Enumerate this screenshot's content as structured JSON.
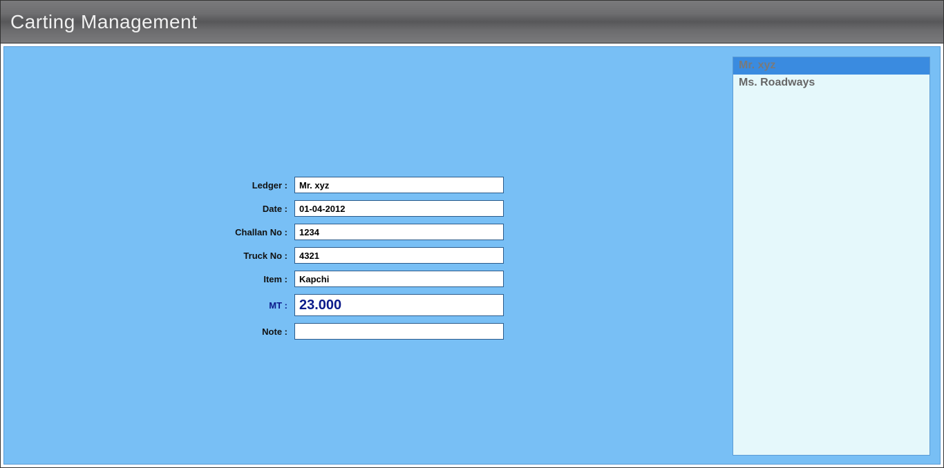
{
  "header": {
    "title": "Carting Management"
  },
  "form": {
    "ledger": {
      "label": "Ledger :",
      "value": "Mr. xyz"
    },
    "date": {
      "label": "Date :",
      "value": "01-04-2012"
    },
    "challan_no": {
      "label": "Challan No :",
      "value": "1234"
    },
    "truck_no": {
      "label": "Truck No :",
      "value": "4321"
    },
    "item": {
      "label": "Item :",
      "value": "Kapchi"
    },
    "mt": {
      "label": "MT :",
      "value": "23.000"
    },
    "note": {
      "label": "Note :",
      "value": ""
    }
  },
  "ledger_list": {
    "items": [
      {
        "name": "Mr. xyz",
        "selected": true
      },
      {
        "name": "Ms. Roadways",
        "selected": false
      }
    ]
  }
}
